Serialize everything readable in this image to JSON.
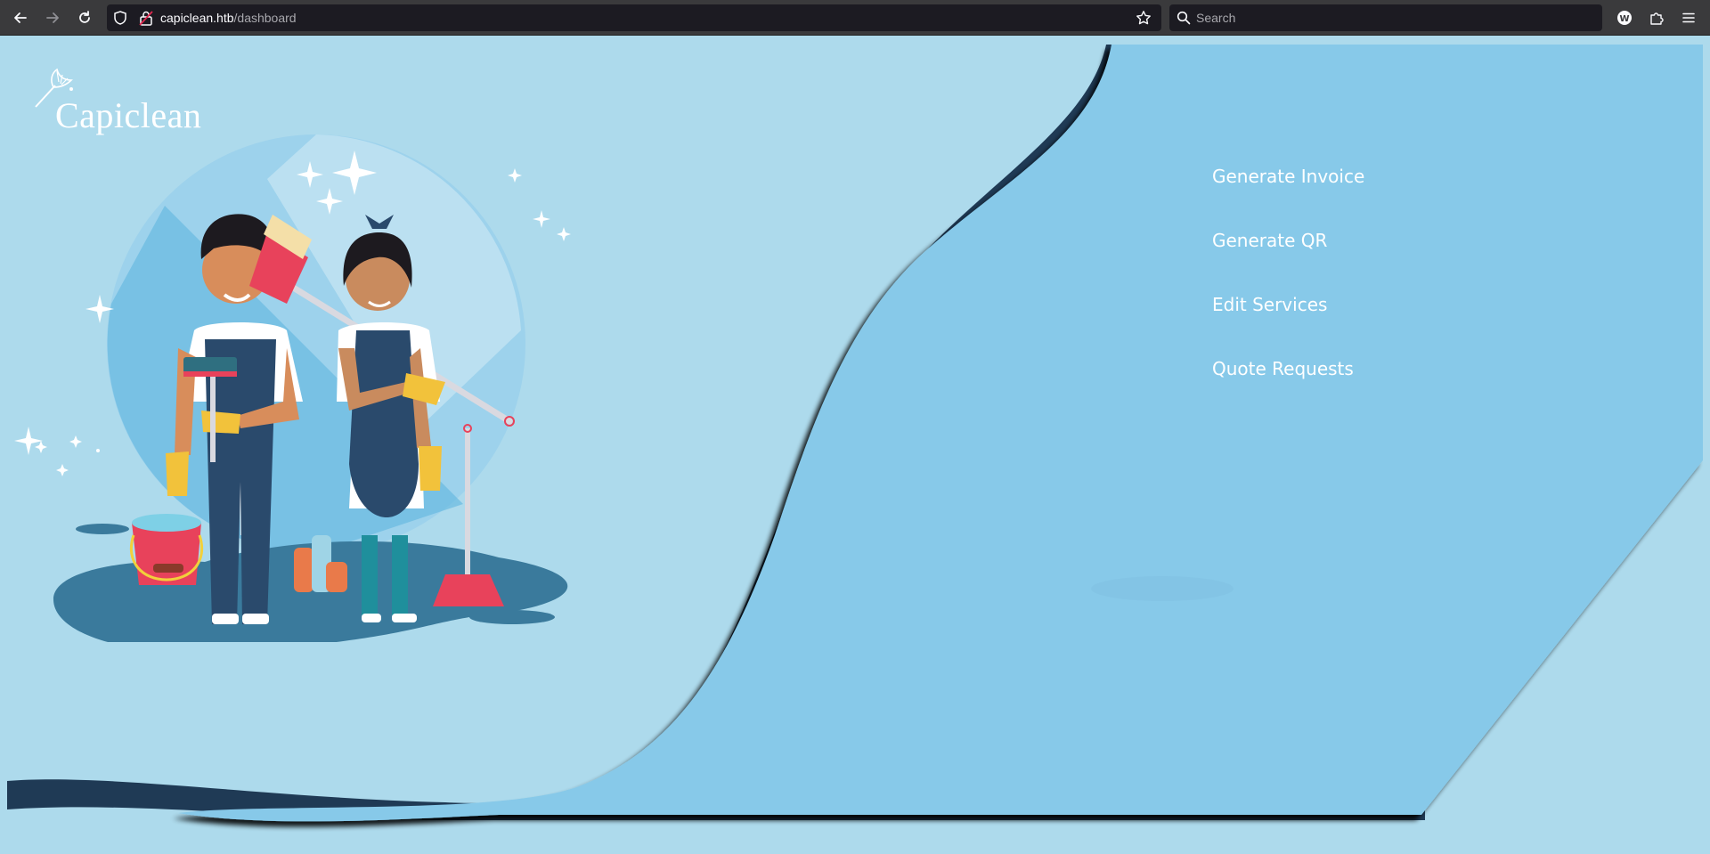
{
  "browser": {
    "url_host": "capiclean.htb",
    "url_path": "/dashboard",
    "search_placeholder": "Search"
  },
  "site": {
    "logo_text": "Capiclean"
  },
  "nav": {
    "items": [
      {
        "label": "Generate Invoice"
      },
      {
        "label": "Generate QR"
      },
      {
        "label": "Edit Services"
      },
      {
        "label": "Quote Requests"
      }
    ]
  },
  "colors": {
    "page_bg": "#addaec",
    "panel_bg": "#87c9e9",
    "shadow": "#1f3a55"
  }
}
